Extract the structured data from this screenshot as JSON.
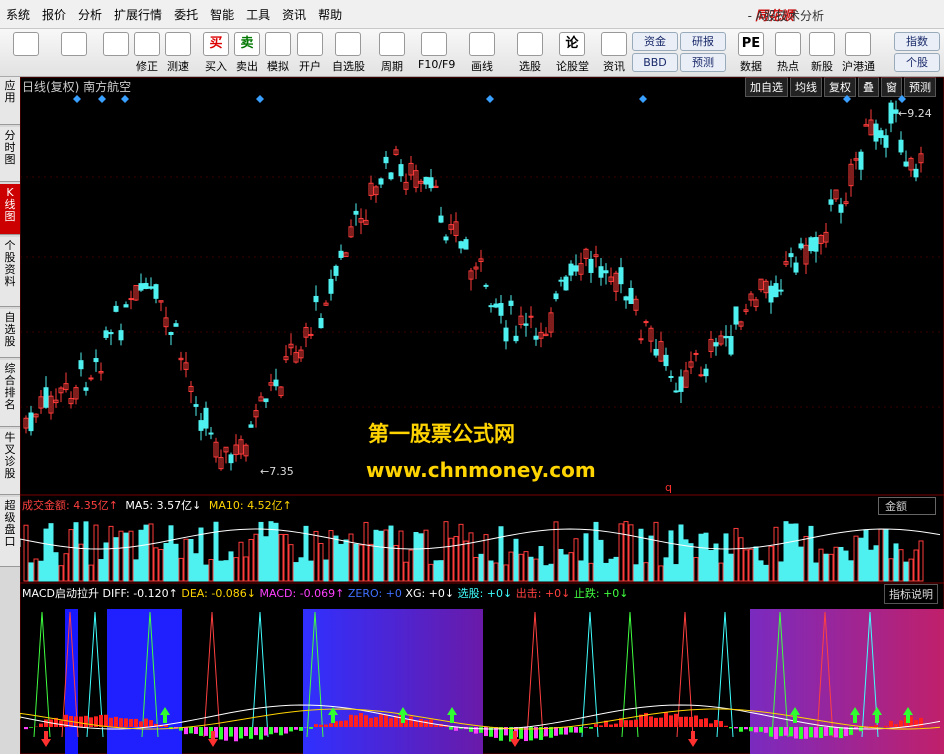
{
  "menu": [
    "系统",
    "报价",
    "分析",
    "扩展行情",
    "委托",
    "智能",
    "工具",
    "资讯",
    "帮助"
  ],
  "brand": "同花顺",
  "app_title": "- A股技术分析",
  "toolbar": {
    "items": [
      {
        "label": "",
        "icon": "grid-icon"
      },
      {
        "label": "",
        "icon": "back-arrow-icon"
      },
      {
        "label": "",
        "icon": "up-down-arrow-icon"
      },
      {
        "label": "修正",
        "icon": "fix-icon"
      },
      {
        "label": "测速",
        "icon": "clock-icon"
      },
      {
        "label": "买入",
        "icon": "buy-icon",
        "glyph": "买"
      },
      {
        "label": "卖出",
        "icon": "sell-icon",
        "glyph": "卖"
      },
      {
        "label": "模拟",
        "icon": "hammer-icon"
      },
      {
        "label": "开户",
        "icon": "lock-icon"
      },
      {
        "label": "自选股",
        "icon": "star-folder-icon"
      },
      {
        "label": "周期",
        "icon": "cycle-icon"
      },
      {
        "label": "F10/F9",
        "icon": "table-icon"
      },
      {
        "label": "画线",
        "icon": "pen-icon"
      },
      {
        "label": "选股",
        "icon": "select-icon"
      },
      {
        "label": "论股堂",
        "icon": "chat-icon",
        "glyph": "论"
      },
      {
        "label": "资讯",
        "icon": "doc-icon"
      },
      {
        "label": "数据",
        "icon": "pe-icon",
        "glyph": "PE"
      },
      {
        "label": "热点",
        "icon": "hot-icon"
      },
      {
        "label": "新股",
        "icon": "new-stock-icon"
      },
      {
        "label": "沪港通",
        "icon": "hk-icon"
      }
    ],
    "pills": [
      "资金",
      "研报",
      "BBD",
      "预测",
      "指数",
      "个股"
    ]
  },
  "sidebar": [
    "应用",
    "分时图",
    "K线图",
    "个股资料",
    "自选股",
    "综合排名",
    "牛叉诊股",
    "超级盘口"
  ],
  "chart": {
    "header": "日线(复权) 南方航空",
    "right_buttons": [
      "加自选",
      "均线",
      "复权",
      "叠",
      "窗",
      "预测"
    ],
    "high_label": "9.24",
    "low_label": "7.35",
    "mark_q": "q"
  },
  "volume": {
    "label": "成交金额: 4.35亿↑",
    "ma5": "MA5: 3.57亿↓",
    "ma10": "MA10: 4.52亿↑",
    "right": "金额"
  },
  "macd": {
    "name": "MACD启动拉升",
    "diff": "DIFF: -0.120↑",
    "dea": "DEA: -0.086↓",
    "macd": "MACD: -0.069↑",
    "zero": "ZERO: +0",
    "xg": "XG: +0↓",
    "xuangu": "选股: +0↓",
    "chuji": "出击: +0↓",
    "zhidie": "止跌: +0↓",
    "explain": "指标说明"
  },
  "watermark": {
    "line1": "第一股票公式网",
    "line2": "www.chnmoney.com"
  },
  "colors": {
    "up": "#ff3b3b",
    "down": "#4ff0f0",
    "ma": "#ffffff",
    "accent": "#d01010"
  }
}
